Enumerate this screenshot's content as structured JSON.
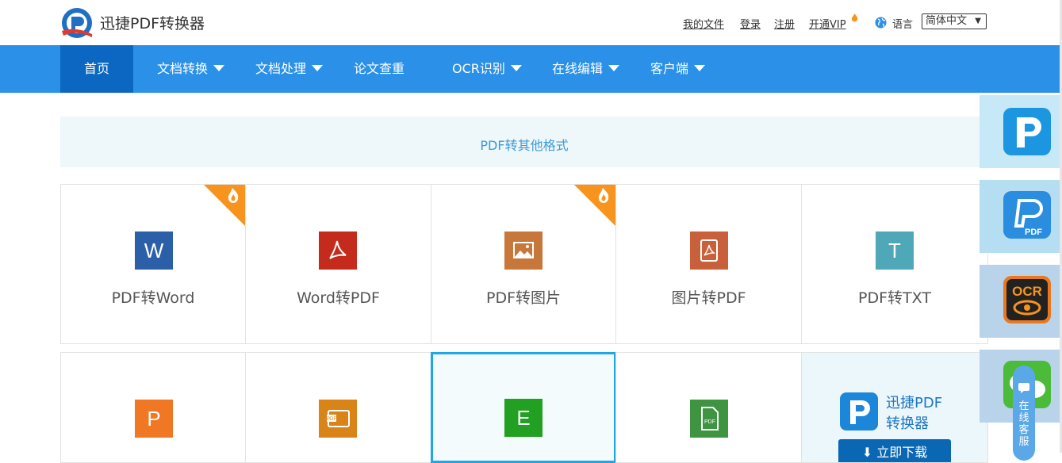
{
  "header": {
    "brand": "迅捷PDF转换器",
    "links": {
      "my_files": "我的文件",
      "login": "登录",
      "register": "注册",
      "vip": "开通VIP"
    },
    "language_label": "语言",
    "language_selected": "简体中文"
  },
  "nav": {
    "items": [
      {
        "label": "首页",
        "active": true,
        "dropdown": false
      },
      {
        "label": "文档转换",
        "dropdown": true
      },
      {
        "label": "文档处理",
        "dropdown": true
      },
      {
        "label": "论文查重",
        "dropdown": false
      },
      {
        "label": "OCR识别",
        "dropdown": true
      },
      {
        "label": "在线编辑",
        "dropdown": true
      },
      {
        "label": "客户端",
        "dropdown": true
      }
    ]
  },
  "section": {
    "title": "PDF转其他格式"
  },
  "tools": {
    "row1": [
      {
        "label": "PDF转Word",
        "icon": "word-icon",
        "glyph": "W",
        "color": "#2b5fa8",
        "hot": true
      },
      {
        "label": "Word转PDF",
        "icon": "pdf-acrobat-icon",
        "glyph": "",
        "color": "#c42b1c",
        "hot": false
      },
      {
        "label": "PDF转图片",
        "icon": "image-icon",
        "glyph": "",
        "color": "#c8773a",
        "hot": true
      },
      {
        "label": "图片转PDF",
        "icon": "pdf-file-icon",
        "glyph": "",
        "color": "#c9603c",
        "hot": false
      },
      {
        "label": "PDF转TXT",
        "icon": "txt-icon",
        "glyph": "T",
        "color": "#4fa8b8",
        "hot": false
      }
    ],
    "row2": [
      {
        "icon": "ppt-icon",
        "glyph": "P",
        "color": "#f07824"
      },
      {
        "icon": "pdf-slides-icon",
        "glyph": "",
        "color": "#d98417"
      },
      {
        "icon": "excel-icon",
        "glyph": "E",
        "color": "#22a022"
      },
      {
        "icon": "pdf-green-icon",
        "glyph": "",
        "color": "#3e9440"
      }
    ]
  },
  "promo": {
    "line1": "迅捷PDF",
    "line2": "转换器",
    "button": "⬇ 立即下载"
  },
  "sidebar": {
    "tiles": [
      {
        "icon": "pdf-converter-app-icon",
        "bg": "#c7e9f7"
      },
      {
        "icon": "pdf-editor-app-icon",
        "bg": "#b6def3"
      },
      {
        "icon": "ocr-app-icon",
        "bg": "#b8d3ea",
        "text": "OCR"
      },
      {
        "icon": "wechat-app-icon",
        "bg": "#b8d3ea"
      }
    ],
    "service": "在线客服"
  },
  "colors": {
    "nav": "#2b90e8",
    "nav_active": "#0b67c2",
    "accent": "#3d9ad8",
    "hot": "#f7941d"
  }
}
